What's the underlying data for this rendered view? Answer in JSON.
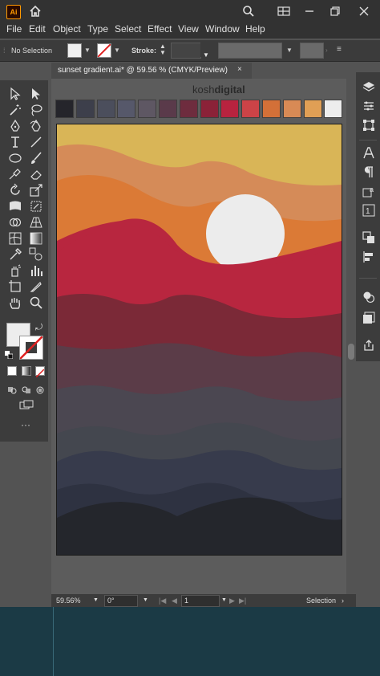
{
  "app": {
    "logo": "Ai"
  },
  "menu": [
    "File",
    "Edit",
    "Object",
    "Type",
    "Select",
    "Effect",
    "View",
    "Window",
    "Help"
  ],
  "control_bar": {
    "selection": "No Selection",
    "stroke_label": "Stroke:"
  },
  "document": {
    "tab_title": "sunset gradient.ai* @ 59.56 % (CMYK/Preview)",
    "close_glyph": "×",
    "brand_light": "kosh",
    "brand_bold": "digital"
  },
  "palette": [
    "#25252b",
    "#3d3f4b",
    "#4b4e5c",
    "#56586a",
    "#5e5763",
    "#5a3a4a",
    "#6e2c3e",
    "#8b2238",
    "#b8233f",
    "#cc4347",
    "#d37038",
    "#d88a55",
    "#e09f55",
    "#ededed"
  ],
  "artwork": {
    "layers": [
      "#d9b557",
      "#d58b58",
      "#db7a36",
      "#b8263f",
      "#7b2937",
      "#5b3c48",
      "#4b4751",
      "#44474f",
      "#373b4c",
      "#2e3241",
      "#24262c"
    ],
    "sun": "#ececec"
  },
  "status": {
    "zoom": "59.56%",
    "rotation": "0°",
    "artboard_num": "1",
    "tool": "Selection"
  },
  "icons": {
    "titlebar": [
      "home-icon",
      "search-icon",
      "workspace-icon",
      "minimize-icon",
      "restore-icon",
      "close-icon"
    ],
    "right_panel": [
      "layers-icon",
      "properties-icon",
      "transform-icon",
      "character-icon",
      "paragraph-icon",
      "glyphs-icon",
      "align-icon",
      "pathfinder-icon",
      "appearance-icon",
      "graphic-styles-icon"
    ]
  }
}
